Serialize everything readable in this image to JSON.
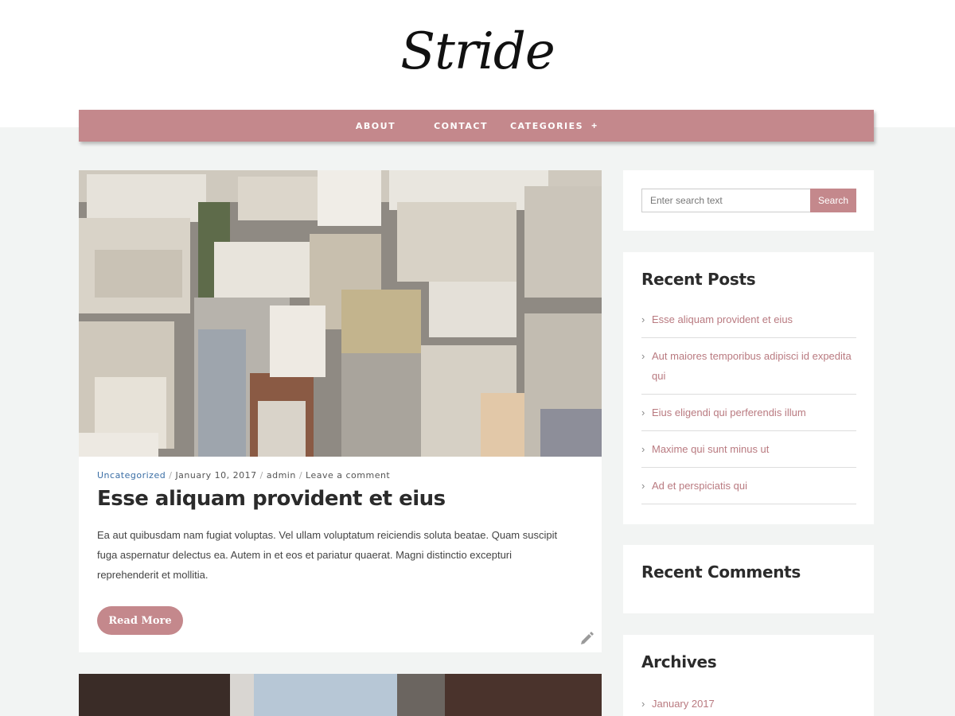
{
  "site": {
    "logo": "Stride"
  },
  "nav": {
    "about": "ABOUT",
    "contact": "CONTACT",
    "categories": "CATEGORIES",
    "categories_toggle": "+"
  },
  "post": {
    "category": "Uncategorized",
    "date": "January 10, 2017",
    "author": "admin",
    "comments": "Leave a comment",
    "title": "Esse aliquam provident et eius",
    "excerpt": "Ea aut quibusdam nam fugiat voluptas. Vel ullam voluptatum reiciendis soluta beatae. Quam suscipit fuga aspernatur delectus ea. Autem in et eos et pariatur quaerat. Magni distinctio excepturi reprehenderit et mollitia.",
    "read_more": "Read More",
    "edit_icon": "pencil-icon"
  },
  "search": {
    "placeholder": "Enter search text",
    "button": "Search"
  },
  "recent_posts": {
    "title": "Recent Posts",
    "items": [
      "Esse aliquam provident et eius",
      "Aut maiores temporibus adipisci id expedita qui",
      "Eius eligendi qui perferendis illum",
      "Maxime qui sunt minus ut",
      "Ad et perspiciatis qui"
    ]
  },
  "recent_comments": {
    "title": "Recent Comments"
  },
  "archives": {
    "title": "Archives",
    "items": [
      "January 2017"
    ]
  },
  "colors": {
    "accent": "#c4888c",
    "link": "#b97a80",
    "meta_link": "#3a6ea5",
    "page_bg": "#f2f4f3"
  }
}
